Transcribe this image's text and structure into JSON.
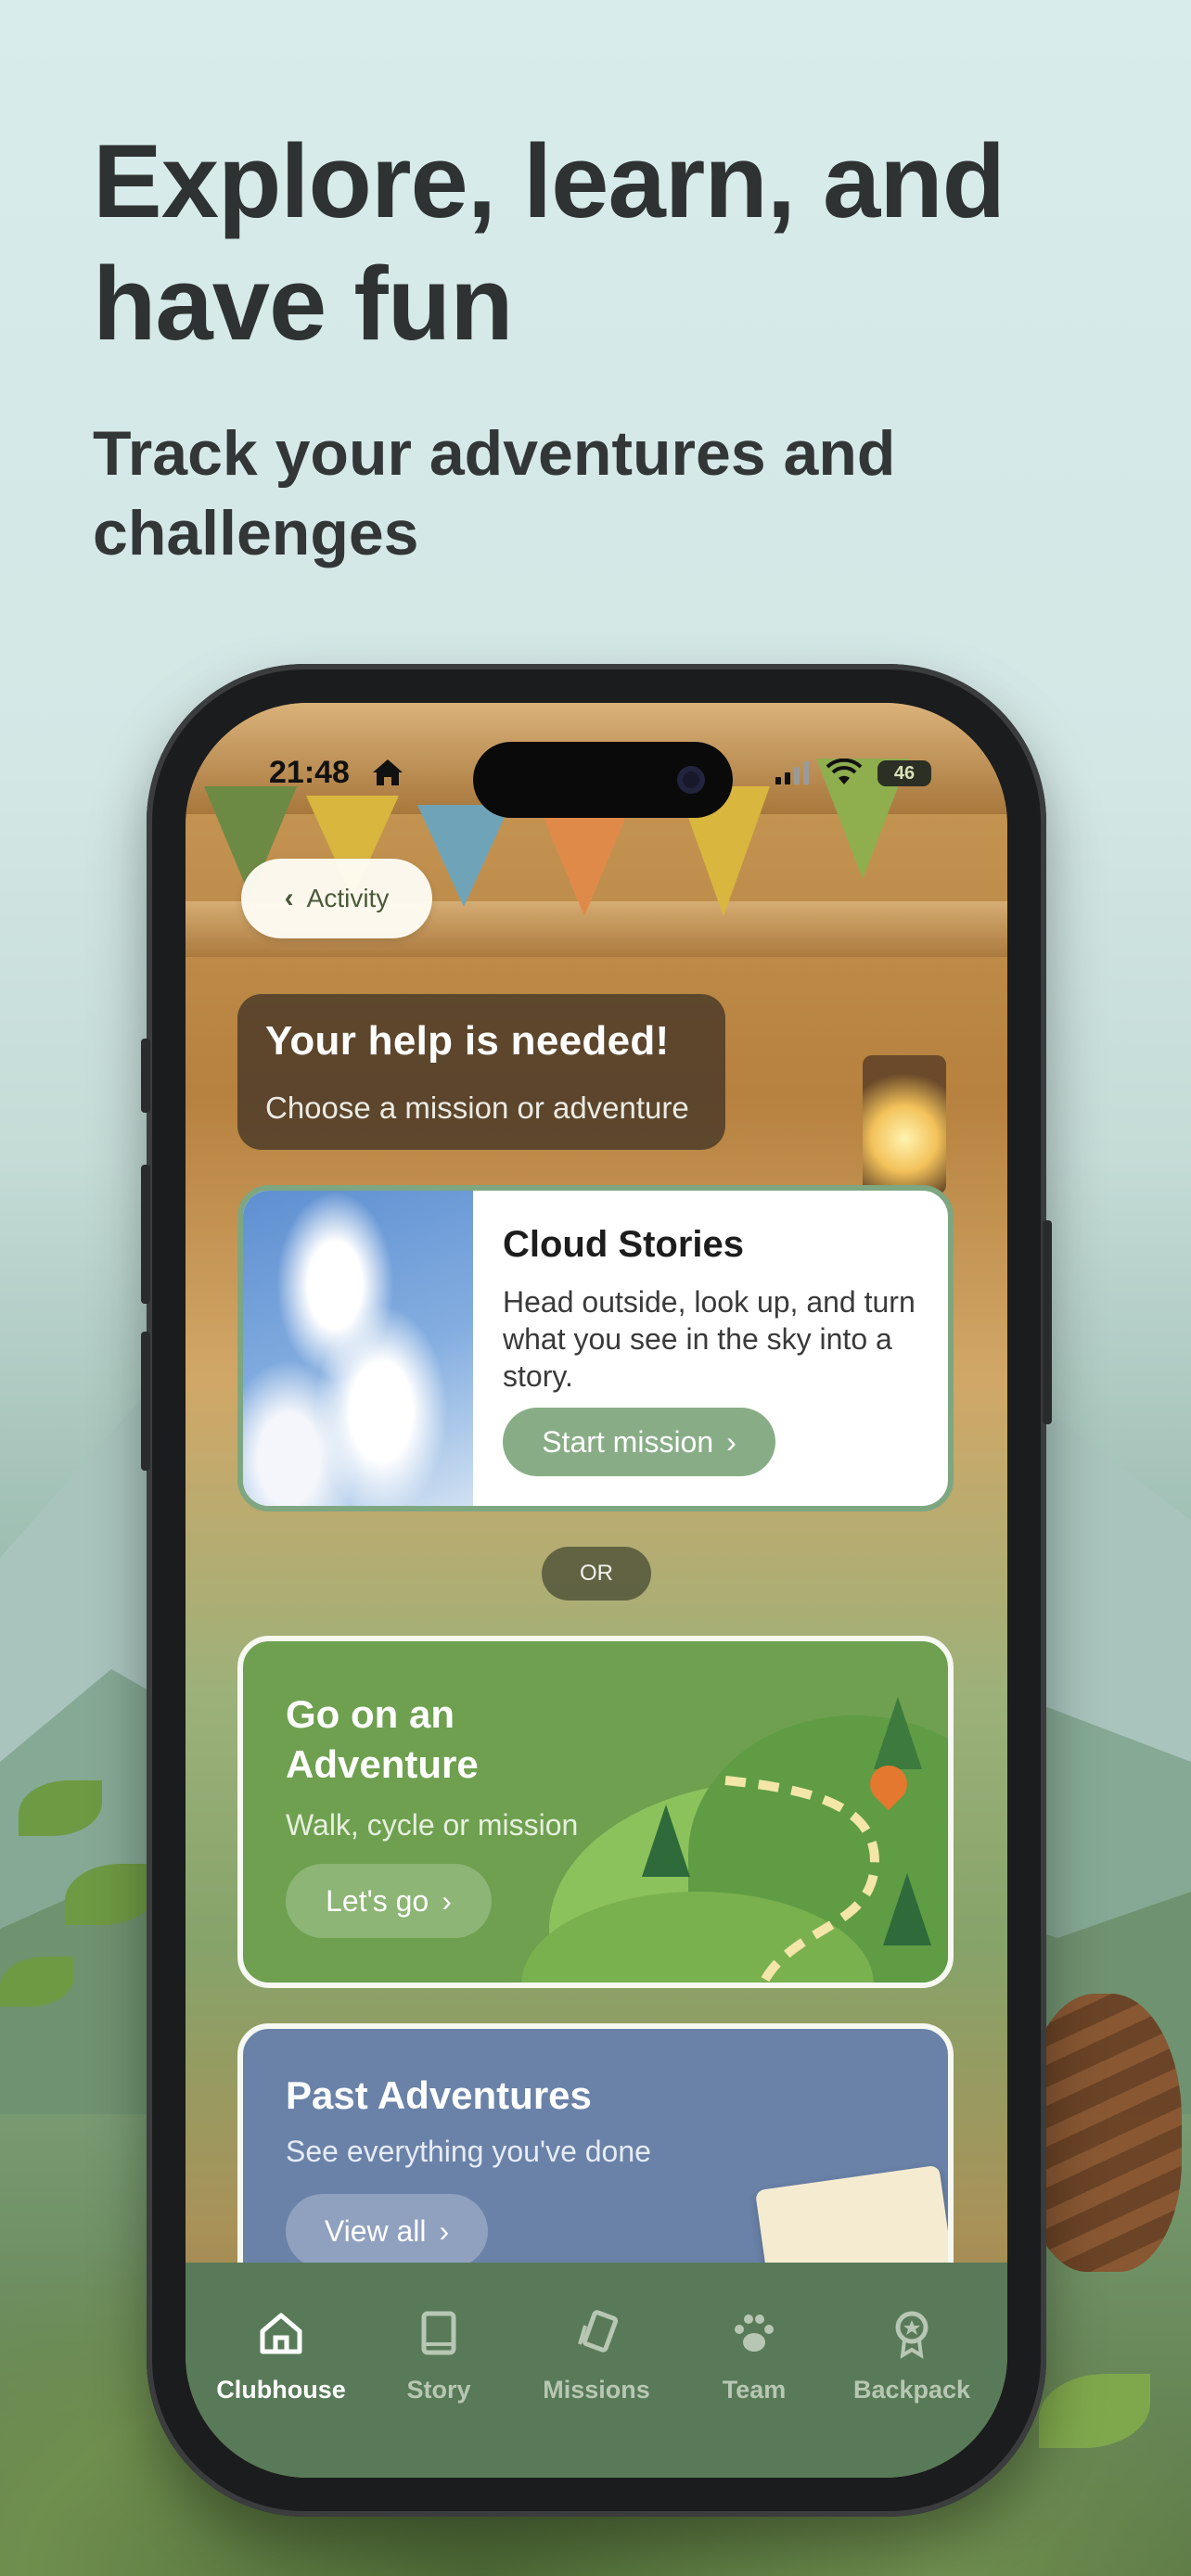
{
  "hero": {
    "title": "Explore, learn, and have fun",
    "subtitle": "Track your adventures and challenges"
  },
  "status_bar": {
    "time": "21:48",
    "battery": "46"
  },
  "back_button": {
    "label": "Activity"
  },
  "help_banner": {
    "title": "Your help is needed!",
    "subtitle": "Choose a mission or adventure"
  },
  "mission_card": {
    "title": "Cloud Stories",
    "description": "Head outside, look up, and turn what you see in the sky into a story.",
    "button": "Start mission"
  },
  "divider": {
    "label": "OR"
  },
  "adventure_card": {
    "title": "Go on an Adventure",
    "subtitle": "Walk, cycle or mission",
    "button": "Let's go"
  },
  "past_card": {
    "title": "Past Adventures",
    "subtitle": "See everything you've done",
    "button": "View all"
  },
  "tab_bar": {
    "active": "Clubhouse",
    "items": [
      {
        "label": "Clubhouse",
        "icon": "home-icon"
      },
      {
        "label": "Story",
        "icon": "book-icon"
      },
      {
        "label": "Missions",
        "icon": "cards-icon"
      },
      {
        "label": "Team",
        "icon": "paw-icon"
      },
      {
        "label": "Backpack",
        "icon": "badge-icon"
      }
    ]
  },
  "colors": {
    "tab_bar": "#587a58",
    "mission_button": "#88ad86",
    "adventure_card": "#6ea050",
    "past_card": "#6a82a8"
  }
}
